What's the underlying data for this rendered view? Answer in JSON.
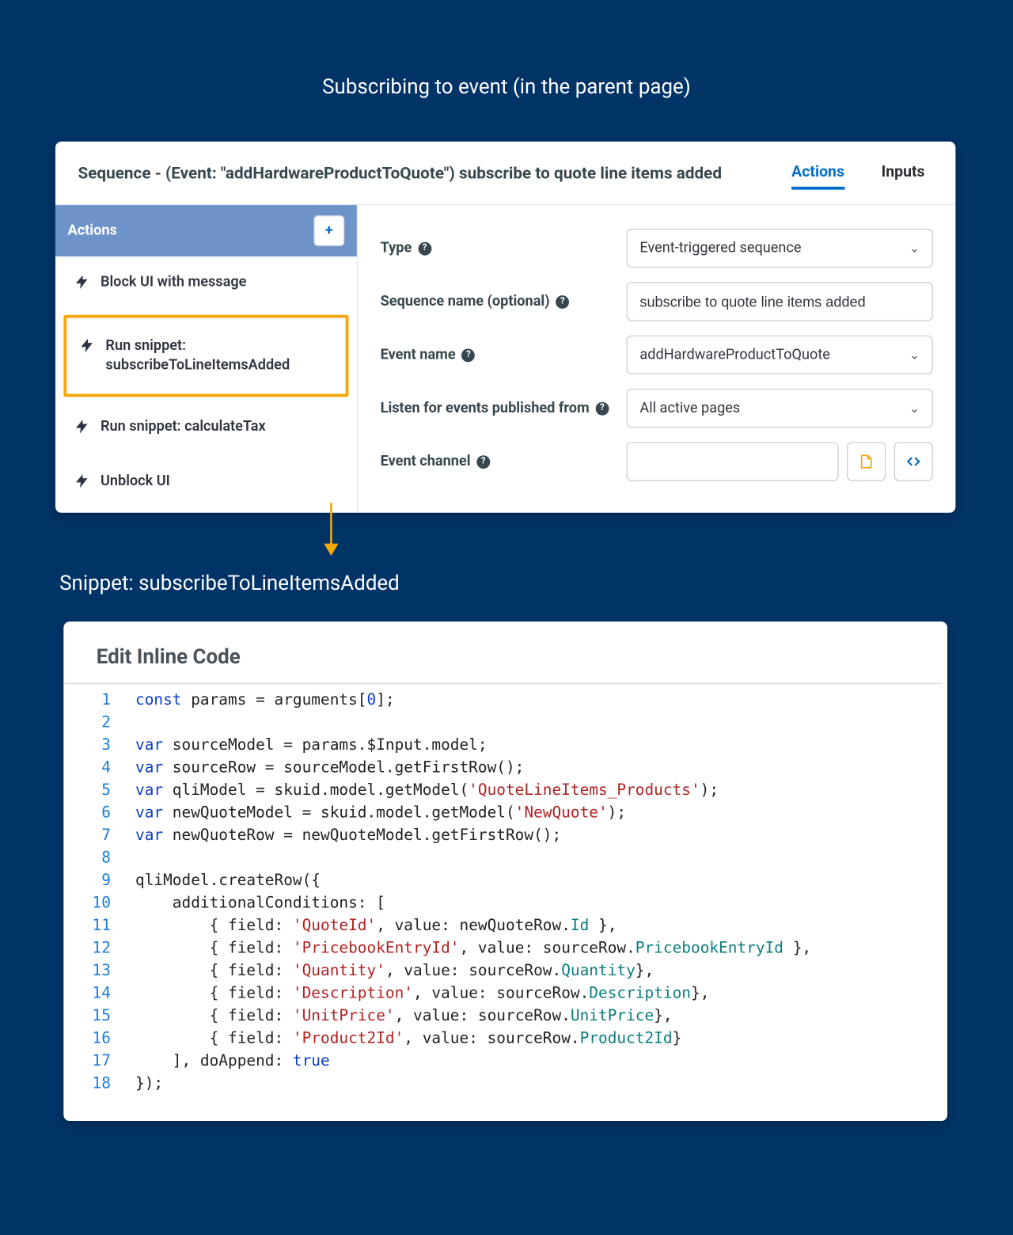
{
  "heading": "Subscribing to event (in the parent page)",
  "panel1_title": "Sequence - (Event: \"addHardwareProductToQuote\") subscribe to quote line items added",
  "tabs": {
    "actions": "Actions",
    "inputs": "Inputs"
  },
  "actions_header": "Actions",
  "action_items": [
    "Block UI with message",
    "Run snippet: subscribeToLineItemsAdded",
    "Run snippet: calculateTax",
    "Unblock UI"
  ],
  "form": {
    "type_label": "Type",
    "type_value": "Event-triggered sequence",
    "seqname_label": "Sequence name (optional)",
    "seqname_value": "subscribe to quote line items added",
    "eventname_label": "Event name",
    "eventname_value": "addHardwareProductToQuote",
    "listen_label": "Listen for events published from",
    "listen_value": "All active pages",
    "channel_label": "Event channel",
    "channel_value": ""
  },
  "snippet_label": "Snippet: subscribeToLineItemsAdded",
  "panel2_title": "Edit Inline Code",
  "code_lines": [
    "const params = arguments[0];",
    "",
    "var sourceModel = params.$Input.model;",
    "var sourceRow = sourceModel.getFirstRow();",
    "var qliModel = skuid.model.getModel('QuoteLineItems_Products');",
    "var newQuoteModel = skuid.model.getModel('NewQuote');",
    "var newQuoteRow = newQuoteModel.getFirstRow();",
    "",
    "qliModel.createRow({",
    "    additionalConditions: [",
    "        { field: 'QuoteId', value: newQuoteRow.Id },",
    "        { field: 'PricebookEntryId', value: sourceRow.PricebookEntryId },",
    "        { field: 'Quantity', value: sourceRow.Quantity},",
    "        { field: 'Description', value: sourceRow.Description},",
    "        { field: 'UnitPrice', value: sourceRow.UnitPrice},",
    "        { field: 'Product2Id', value: sourceRow.Product2Id}",
    "    ], doAppend: true",
    "});"
  ]
}
